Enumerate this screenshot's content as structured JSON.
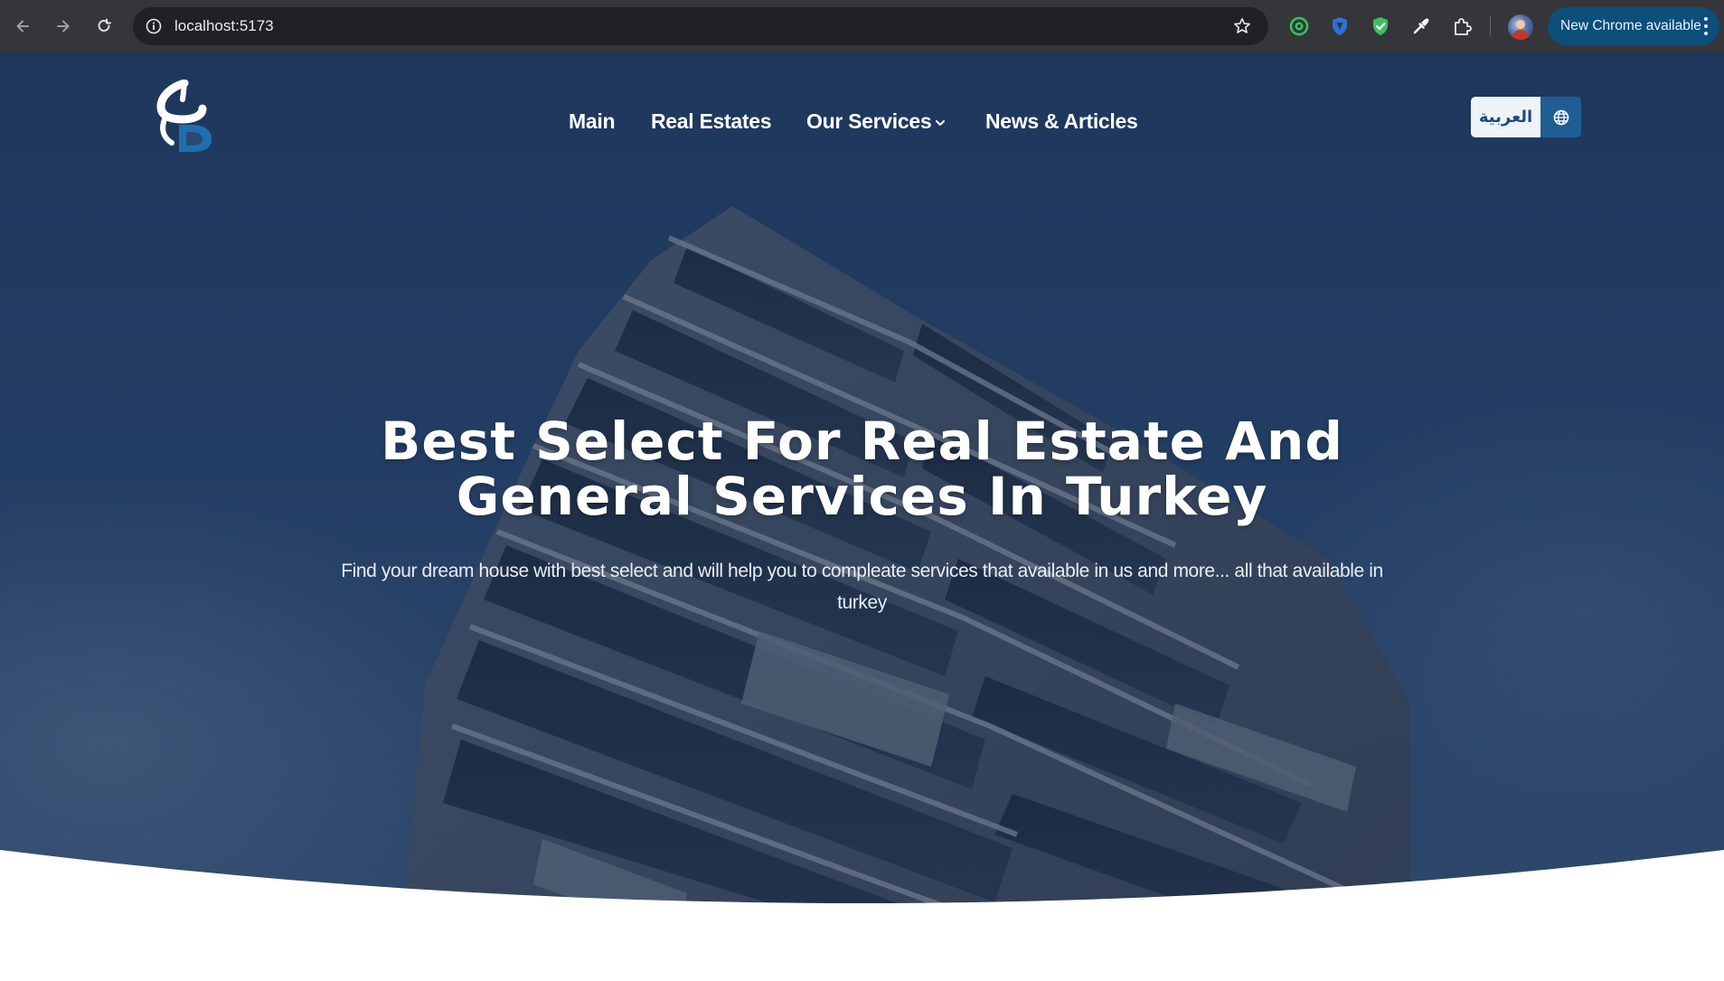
{
  "browser": {
    "url": "localhost:5173",
    "update_label": "New Chrome available",
    "icons": {
      "back": "arrow-left-icon",
      "forward": "arrow-right-icon",
      "reload": "reload-icon",
      "site_info": "info-icon",
      "bookmark": "star-icon",
      "extensions": [
        "green-ring-extension-icon",
        "shield-extension-icon",
        "green-shield-check-extension-icon",
        "eyedropper-extension-icon",
        "puzzle-extensions-icon"
      ],
      "profile": "avatar-icon",
      "menu": "three-dots-menu-icon"
    }
  },
  "header": {
    "logo": "brand-logo-icon",
    "nav": {
      "main": "Main",
      "real_estates": "Real Estates",
      "our_services": "Our Services",
      "news": "News & Articles"
    },
    "language_button": "العربية",
    "language_icon": "globe-icon"
  },
  "hero": {
    "title_line1": "Best Select For Real Estate And",
    "title_line2": "General Services In Turkey",
    "subtitle_line1": "Find your dream house with best select and will help you to compleate services that available in us and more... all that available in",
    "subtitle_line2": "turkey"
  },
  "colors": {
    "chrome_bg": "#35363a",
    "omnibox_bg": "#202124",
    "update_pill": "#0b4f7a",
    "hero_overlay": "#1f3a62",
    "lang_button_bg": "#eef3f8",
    "lang_button_text": "#1f4a7a",
    "globe_button_bg": "#1f5e93"
  }
}
